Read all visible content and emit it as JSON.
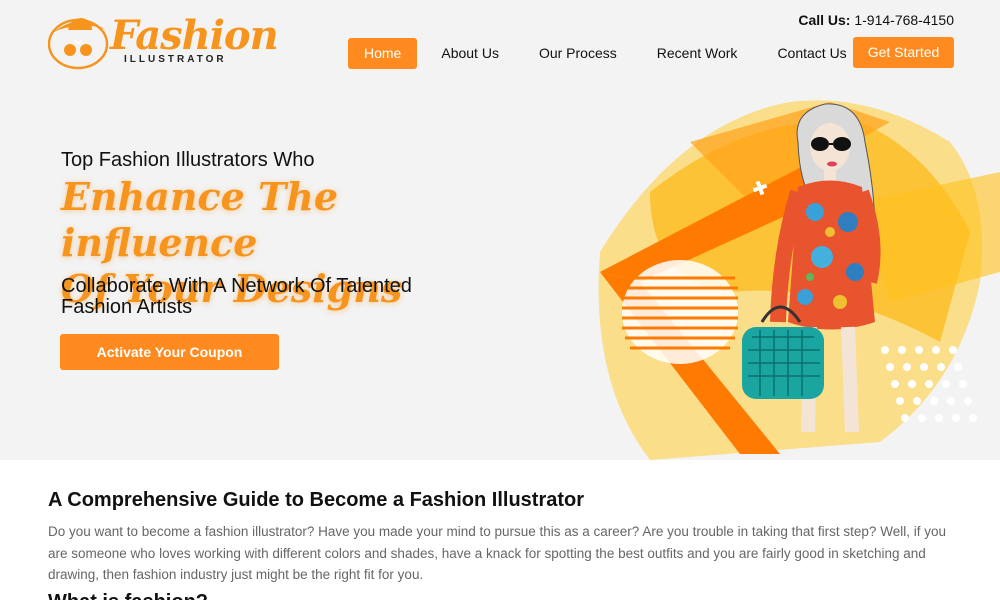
{
  "brand": {
    "name": "Fashion",
    "tagline": "ILLUSTRATOR",
    "accent_color": "#ff8a1f"
  },
  "contact": {
    "label": "Call Us:",
    "phone": "1-914-768-4150"
  },
  "nav": {
    "items": [
      {
        "label": "Home",
        "active": true
      },
      {
        "label": "About Us",
        "active": false
      },
      {
        "label": "Our Process",
        "active": false
      },
      {
        "label": "Recent Work",
        "active": false
      },
      {
        "label": "Contact Us",
        "active": false
      }
    ],
    "cta_label": "Get Started"
  },
  "hero": {
    "pre_title": "Top Fashion Illustrators Who",
    "title_line1": "Enhance The influence",
    "title_line2": "Of Your Designs",
    "subtitle": "Collaborate With A Network Of Talented Fashion Artists",
    "button_label": "Activate Your Coupon",
    "image_icon": "fashion-illustration-image"
  },
  "guide": {
    "title": "A Comprehensive Guide to Become a Fashion Illustrator",
    "body": "Do you want to become a fashion illustrator? Have you made your mind to pursue this as a career? Are you trouble in taking that first step? Well, if you are someone who loves working with different colors and shades, have a knack for spotting the best outfits and you are fairly good in sketching and drawing, then fashion industry just might be the right fit for you.",
    "next_heading": "What is fashion?"
  }
}
